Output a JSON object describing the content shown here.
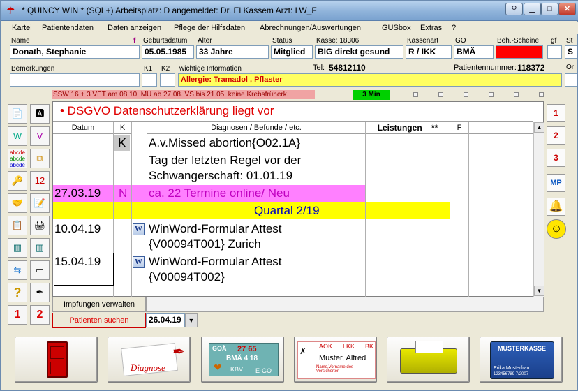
{
  "title": "* QUINCY WIN * (SQL+) Arbeitsplatz: D     angemeldet: Dr. El Kassem     Arzt: LW_F",
  "menu": [
    "Kartei",
    "Patientendaten",
    "Daten anzeigen",
    "Pflege der Hilfsdaten",
    "Abrechnungen/Auswertungen",
    "GUSbox",
    "Extras",
    "?"
  ],
  "labels": {
    "name": "Name",
    "f": "f",
    "geb": "Geburtsdatum",
    "alter": "Alter",
    "status": "Status",
    "kasse": "Kasse: 18306",
    "kassenart": "Kassenart",
    "go": "GO",
    "beh": "Beh.-Scheine",
    "gf": "gf",
    "st": "St",
    "bemerkungen": "Bemerkungen",
    "k1": "K1",
    "k2": "K2",
    "wichtig": "wichtige Information",
    "tel_label": "Tel:",
    "patnr_label": "Patientennummer:",
    "or": "Or"
  },
  "patient": {
    "name": "Donath, Stephanie",
    "geb": "05.05.1985",
    "alter": "33 Jahre",
    "status": "Mitglied",
    "kasse": "BIG direkt gesund",
    "kassenart": "R / IKK",
    "go": "BMÄ",
    "st": "S",
    "allergie": "Allergie: Tramadol ,  Pflaster",
    "tel": "54812110",
    "patnr": "118372"
  },
  "ssw": "SSW 16 + 3  VET am 08.10.  MU ab 27.08.  VS bis 21.05.  keine Krebsfrüherk.",
  "timer": "3 Min",
  "dsgvo": "•  DSGVO Datenschutzerklärung liegt vor",
  "columns": {
    "datum": "Datum",
    "k": "K",
    "diagnosen": "Diagnosen / Befunde / etc.",
    "leistungen": "Leistungen",
    "stars": "**",
    "f": "F"
  },
  "entries": {
    "k1": "K",
    "d1": "A.v.Missed abortion{O02.1A}",
    "d2a": "Tag der letzten Regel vor der",
    "d2b": "Schwangerschaft: 01.01.19",
    "date3": "27.03.19",
    "k3": "N",
    "d3": "ca. 22 Termine online/ Neu",
    "quartal": "Quartal     2/19",
    "date4": "10.04.19",
    "d4a": "WinWord-Formular Attest",
    "d4b": "{V00094T001} Zurich",
    "date5": "15.04.19",
    "d5a": "WinWord-Formular Attest",
    "d5b": "{V00094T002}"
  },
  "right_tabs": [
    "1",
    "2",
    "3",
    "MP"
  ],
  "impfungen": "Impfungen verwalten",
  "patienten_suchen": "Patienten suchen",
  "search_date": "26.04.19",
  "tiles": {
    "diagnose_text": "Diagnose",
    "gebo": {
      "left": "GOÄ",
      "nums": "27  65",
      "mid": "BMÄ 4  18",
      "kbv": "KBV",
      "ego": "E-GO"
    },
    "card": {
      "aok": "AOK",
      "lkk": "LKK",
      "bk": "BK",
      "name": "Muster, Alfred",
      "sub": "Name,Vorname des Versicherten"
    },
    "kasse": {
      "title": "MUSTERKASSE",
      "name": "Erika Musterfrau",
      "num": "123456789   7/2007"
    }
  },
  "colors": {
    "allergy_bg": "#ffff60",
    "alert_red": "#ff0000",
    "quartal_bg": "#ffff00",
    "pink_row": "#ff80ff"
  }
}
